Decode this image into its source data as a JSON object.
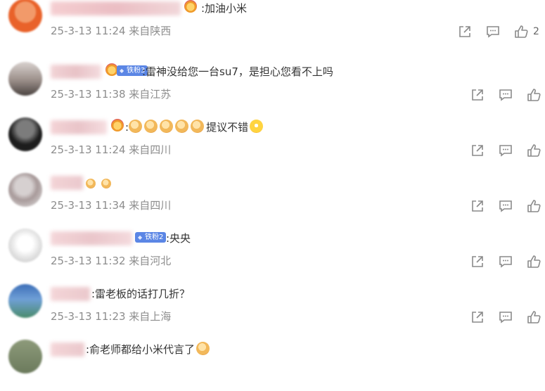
{
  "comments": [
    {
      "text": ":加油小米",
      "meta": "25-3-13 11:24 来自陕西",
      "likes": "2"
    },
    {
      "fan_badge": "铁粉3",
      "text": ":雷神没给您一台su7，是担心您看不上吗",
      "meta": "25-3-13 11:38 来自江苏"
    },
    {
      "text_prefix": ":",
      "text": "提议不错",
      "meta": "25-3-13 11:24 来自四川"
    },
    {
      "meta": "25-3-13 11:34 来自四川"
    },
    {
      "fan_badge": "铁粉2",
      "text": ":央央",
      "meta": "25-3-13 11:32 来自河北"
    },
    {
      "text": ":雷老板的话打几折？",
      "meta": "25-3-13 11:23 来自上海"
    },
    {
      "text": ":俞老师都给小米代言了"
    }
  ],
  "colors": {
    "meta_text": "#8d8d8d",
    "body_text": "#333333",
    "fan_badge": "#5b86e5",
    "icon": "#8a8a8a"
  },
  "icons": [
    "share-icon",
    "comment-icon",
    "like-icon"
  ]
}
